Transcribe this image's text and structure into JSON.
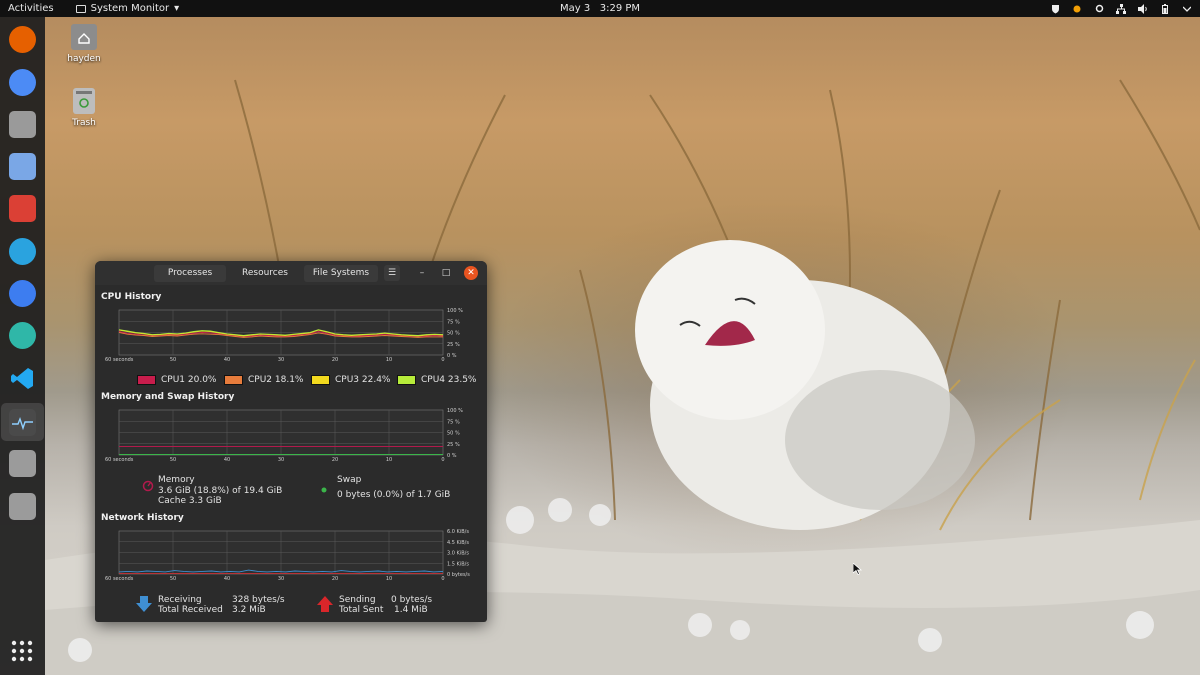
{
  "topbar": {
    "activities": "Activities",
    "app_name": "System Monitor",
    "app_caret": "▾",
    "clock_date": "May 3",
    "clock_time": "3:29 PM"
  },
  "dock": {
    "items": [
      {
        "name": "firefox-icon",
        "color": "#e66000"
      },
      {
        "name": "chromium-icon",
        "color": "#4c8bf5"
      },
      {
        "name": "files-icon",
        "color": "#9a9a9a"
      },
      {
        "name": "mail-icon",
        "color": "#7aa7e6"
      },
      {
        "name": "todoist-icon",
        "color": "#db4035"
      },
      {
        "name": "telegram-icon",
        "color": "#2aa3df"
      },
      {
        "name": "cloud-icon",
        "color": "#3d7df0"
      },
      {
        "name": "remote-icon",
        "color": "#2fb7a8"
      },
      {
        "name": "vscode-icon",
        "color": "#23a9f2"
      },
      {
        "name": "system-monitor-icon",
        "color": "#4a4a4a"
      },
      {
        "name": "drive-icon-1",
        "color": "#9b9b9b"
      },
      {
        "name": "drive-icon-2",
        "color": "#9b9b9b"
      }
    ],
    "apps_grid": "show-applications-icon"
  },
  "desktop": {
    "home_label": "hayden",
    "trash_label": "Trash"
  },
  "sysmon": {
    "tabs": [
      "Processes",
      "Resources",
      "File Systems"
    ],
    "menu_icon": "☰",
    "minimize": "–",
    "maximize": "□",
    "close": "✕",
    "cpu": {
      "title": "CPU History",
      "x_ticks": [
        "60 seconds",
        "50",
        "40",
        "30",
        "20",
        "10",
        "0"
      ],
      "y_ticks": [
        "100 %",
        "75 %",
        "50 %",
        "25 %",
        "0 %"
      ],
      "legend": [
        {
          "label": "CPU1",
          "value": "20.0%",
          "color": "#c81d4c"
        },
        {
          "label": "CPU2",
          "value": "18.1%",
          "color": "#e77c3c"
        },
        {
          "label": "CPU3",
          "value": "22.4%",
          "color": "#f2d91e"
        },
        {
          "label": "CPU4",
          "value": "23.5%",
          "color": "#b7ec3a"
        }
      ]
    },
    "memory": {
      "title": "Memory and Swap History",
      "x_ticks": [
        "60 seconds",
        "50",
        "40",
        "30",
        "20",
        "10",
        "0"
      ],
      "y_ticks": [
        "100 %",
        "75 %",
        "50 %",
        "25 %",
        "0 %"
      ],
      "mem_label": "Memory",
      "mem_value": "3.6 GiB (18.8%) of 19.4 GiB",
      "cache_value": "Cache 3.3 GiB",
      "swap_label": "Swap",
      "swap_value": "0 bytes (0.0%) of 1.7 GiB",
      "mem_color": "#b21a4c",
      "swap_color": "#3bb54a"
    },
    "network": {
      "title": "Network History",
      "x_ticks": [
        "60 seconds",
        "50",
        "40",
        "30",
        "20",
        "10",
        "0"
      ],
      "y_ticks": [
        "6.0 KiB/s",
        "4.5 KiB/s",
        "3.0 KiB/s",
        "1.5 KiB/s",
        "0 bytes/s"
      ],
      "receiving_label": "Receiving",
      "receiving_value": "328 bytes/s",
      "total_received_label": "Total Received",
      "total_received_value": "3.2 MiB",
      "sending_label": "Sending",
      "sending_value": "0 bytes/s",
      "total_sent_label": "Total Sent",
      "total_sent_value": "1.4 MiB",
      "recv_color": "#3f8fd2",
      "send_color": "#d9262a"
    }
  }
}
